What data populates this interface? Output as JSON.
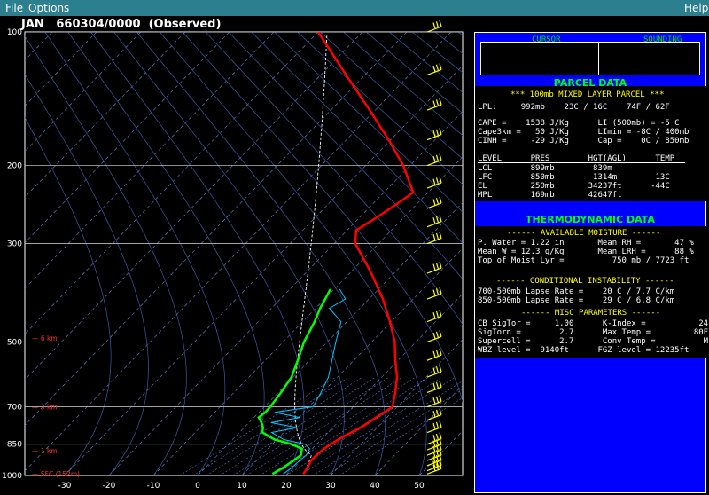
{
  "menu": {
    "file": "File",
    "options": "Options",
    "help": "Help"
  },
  "title": "JAN   660304/0000  (Observed)",
  "chart_data": {
    "type": "skew-t",
    "pressure_ticks": [
      100,
      200,
      300,
      500,
      700,
      850,
      1000
    ],
    "temp_ticks": [
      -30,
      -20,
      -10,
      0,
      10,
      20,
      30,
      40,
      50
    ],
    "height_labels": [
      {
        "p": 490,
        "label": "6 km"
      },
      {
        "p": 700,
        "label": "3 km"
      },
      {
        "p": 880,
        "label": "1 km"
      },
      {
        "p": 990,
        "label": "SFC (152m)"
      }
    ],
    "temperature": [
      [
        992,
        23
      ],
      [
        960,
        20.5
      ],
      [
        925,
        17.5
      ],
      [
        900,
        16
      ],
      [
        870,
        14.5
      ],
      [
        850,
        13.8
      ],
      [
        820,
        13.2
      ],
      [
        780,
        13
      ],
      [
        740,
        12.2
      ],
      [
        700,
        11.6
      ],
      [
        650,
        6.8
      ],
      [
        600,
        1.8
      ],
      [
        550,
        -4
      ],
      [
        500,
        -9.5
      ],
      [
        450,
        -16
      ],
      [
        400,
        -23
      ],
      [
        350,
        -31
      ],
      [
        300,
        -40
      ],
      [
        280,
        -42
      ],
      [
        260,
        -39
      ],
      [
        240,
        -36
      ],
      [
        230,
        -34.5
      ],
      [
        200,
        -40
      ],
      [
        175,
        -46
      ],
      [
        150,
        -53
      ],
      [
        125,
        -61
      ],
      [
        100,
        -70
      ]
    ],
    "dewpoint": [
      [
        992,
        16
      ],
      [
        960,
        15
      ],
      [
        925,
        13.5
      ],
      [
        900,
        12.5
      ],
      [
        870,
        9.5
      ],
      [
        850,
        5
      ],
      [
        830,
        -1
      ],
      [
        800,
        -7
      ],
      [
        780,
        -9
      ],
      [
        760,
        -11.5
      ],
      [
        740,
        -14.3
      ],
      [
        720,
        -15
      ],
      [
        700,
        -16
      ],
      [
        650,
        -19
      ],
      [
        600,
        -22
      ],
      [
        550,
        -26
      ],
      [
        500,
        -30
      ],
      [
        450,
        -33
      ],
      [
        420,
        -35
      ],
      [
        400,
        -36
      ],
      [
        380,
        -37
      ]
    ],
    "wind_levels_hpa": [
      992,
      975,
      950,
      925,
      900,
      875,
      850,
      800,
      750,
      700,
      650,
      600,
      550,
      500,
      450,
      400,
      350,
      300,
      275,
      250,
      225,
      200,
      175,
      150,
      125,
      100
    ]
  },
  "cursor": {
    "label": "CURSOR",
    "sounding_label": "SOUNDING"
  },
  "parcel": {
    "header": "PARCEL DATA",
    "subtitle": "*** 100mb MIXED LAYER PARCEL ***",
    "lpl": "LPL:     992mb    23C / 16C    74F / 62F",
    "cape": "CAPE =    1538 J/Kg      LI (500mb) = -5 C",
    "cape3": "Cape3km =   50 J/Kg      LImin = -8C / 400mb",
    "cinh": "CINH =     -29 J/Kg      Cap =    0C / 850mb",
    "table_header": "LEVEL      PRES        HGT(AGL)      TEMP",
    "lcl": "LCL        899mb        839m",
    "lfc": "LFC        850mb        1314m        13C",
    "el": "EL         250mb       34237ft      -44C",
    "mpl": "MPL        169mb       42647ft"
  },
  "thermo": {
    "header": "THERMODYNAMIC DATA",
    "moisture_title": "------ AVAILABLE MOISTURE ------",
    "pw": "P. Water = 1.22 in       Mean RH =       47 %",
    "meanw": "Mean W = 12.3 g/Kg       Mean LRH =      88 %",
    "moist": "Top of Moist Lyr =          750 mb / 7723 ft",
    "instab_title": "------ CONDITIONAL INSTABILITY ------",
    "lr1": "700-500mb Lapse Rate =    20 C / 7.7 C/km",
    "lr2": "850-500mb Lapse Rate =    29 C / 6.8 C/km",
    "misc_title": "------ MISC PARAMETERS ------",
    "misc1": "CB SigTor =     1.00      K-Index =           24",
    "misc2": "SigTorn =        2.7      Max Temp =         80F",
    "misc3": "Supercell =      2.7      Conv Temp =          M",
    "misc4": "WBZ level =  9140ft      FGZ level = 12235ft"
  },
  "colors": {
    "temperature": "#ff0000",
    "dewpoint": "#00ff00",
    "wetbulb": "#00c8ff",
    "grid": "#3a5aa8",
    "isotherm": "#6a8ad8"
  }
}
